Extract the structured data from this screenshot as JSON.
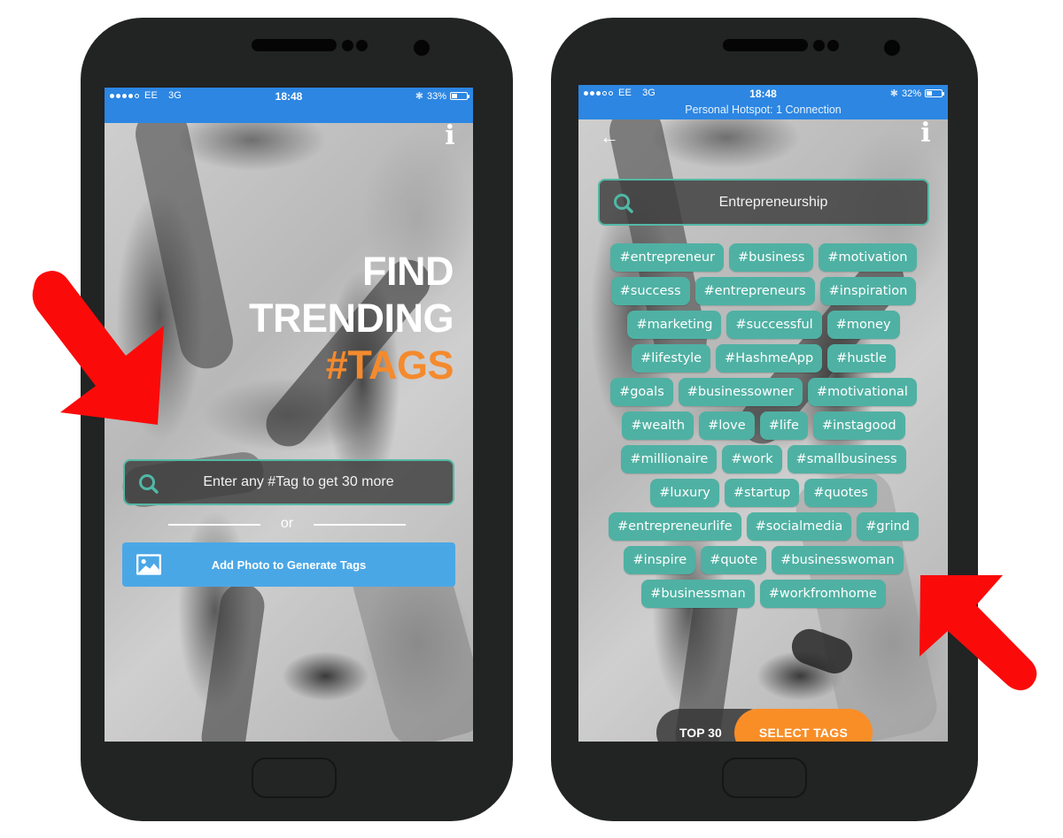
{
  "colors": {
    "statusbar": "#2c86e2",
    "accent_orange": "#f48a2d",
    "tag_teal": "#4fb1a3",
    "photo_button_blue": "#4aa7e6",
    "arrow_red": "#fb0a0a",
    "phone_body": "#222323"
  },
  "left_phone": {
    "status": {
      "carrier": "EE",
      "network": "3G",
      "time": "18:48",
      "battery": "33%",
      "battery_level": 0.33,
      "signal_bars": 4
    },
    "info_icon": "i",
    "headline": {
      "line1": "FIND",
      "line2": "TRENDING",
      "line3": "#TAGS"
    },
    "search": {
      "placeholder": "Enter any #Tag to get 30 more",
      "icon": "search-icon"
    },
    "or_label": "or",
    "photo_button": {
      "label": "Add Photo to Generate Tags",
      "icon": "image-icon"
    }
  },
  "right_phone": {
    "status": {
      "carrier": "EE",
      "network": "3G",
      "time": "18:48",
      "battery": "32%",
      "battery_level": 0.32,
      "signal_bars": 3,
      "hotspot": "Personal Hotspot: 1 Connection"
    },
    "back_icon": "←",
    "info_icon": "i",
    "search": {
      "value": "Entrepreneurship",
      "icon": "search-icon"
    },
    "tag_rows": [
      [
        "#entrepreneur",
        "#business",
        "#motivation"
      ],
      [
        "#success",
        "#entrepreneurs",
        "#inspiration"
      ],
      [
        "#marketing",
        "#successful",
        "#money"
      ],
      [
        "#lifestyle",
        "#HashmeApp",
        "#hustle"
      ],
      [
        "#goals",
        "#businessowner",
        "#motivational"
      ],
      [
        "#wealth",
        "#love",
        "#life",
        "#instagood"
      ],
      [
        "#millionaire",
        "#work",
        "#smallbusiness"
      ],
      [
        "#luxury",
        "#startup",
        "#quotes"
      ],
      [
        "#entrepreneurlife",
        "#socialmedia",
        "#grind"
      ],
      [
        "#inspire",
        "#quote",
        "#businesswoman"
      ],
      [
        "#businessman",
        "#workfromhome"
      ]
    ],
    "top30_label": "TOP 30",
    "select_tags_label": "SELECT TAGS"
  }
}
